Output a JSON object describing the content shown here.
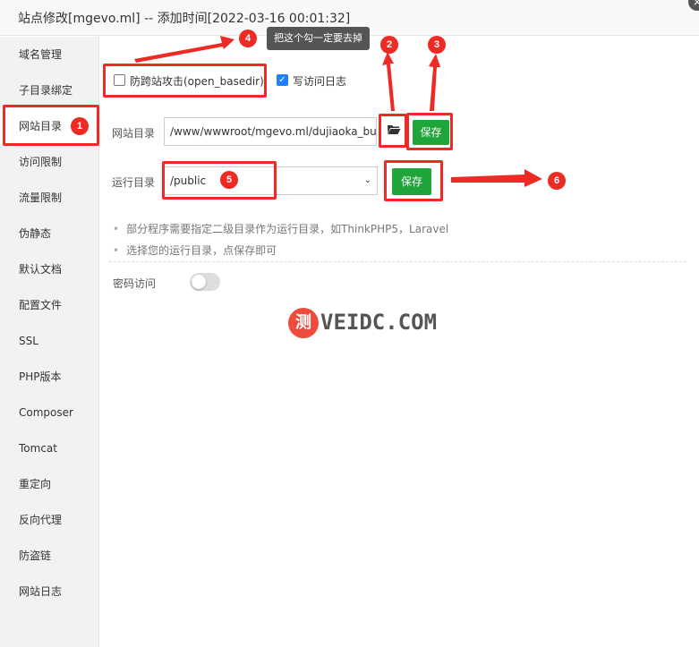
{
  "window": {
    "title": "站点修改[mgevo.ml] -- 添加时间[2022-03-16 00:01:32]",
    "close_icon": "×"
  },
  "sidebar": {
    "items": [
      {
        "label": "域名管理"
      },
      {
        "label": "子目录绑定"
      },
      {
        "label": "网站目录",
        "active": true
      },
      {
        "label": "访问限制"
      },
      {
        "label": "流量限制"
      },
      {
        "label": "伪静态"
      },
      {
        "label": "默认文档"
      },
      {
        "label": "配置文件"
      },
      {
        "label": "SSL"
      },
      {
        "label": "PHP版本"
      },
      {
        "label": "Composer"
      },
      {
        "label": "Tomcat"
      },
      {
        "label": "重定向"
      },
      {
        "label": "反向代理"
      },
      {
        "label": "防盗链"
      },
      {
        "label": "网站日志"
      }
    ]
  },
  "main": {
    "options": {
      "anti_xss_label": "防跨站攻击(open_basedir)",
      "anti_xss_checked": false,
      "access_log_label": "写访问日志",
      "access_log_checked": true,
      "check_glyph": "✓"
    },
    "site_dir": {
      "label": "网站目录",
      "value": "/www/wwwroot/mgevo.ml/dujiaoka_bui",
      "folder_icon": "folder-open-icon",
      "save_label": "保存"
    },
    "run_dir": {
      "label": "运行目录",
      "value": "/public",
      "arrow": "⌄",
      "save_label": "保存"
    },
    "tips": [
      "部分程序需要指定二级目录作为运行目录，如ThinkPHP5，Laravel",
      "选择您的运行目录，点保存即可"
    ],
    "password_access": {
      "label": "密码访问",
      "enabled": false
    }
  },
  "annotations": {
    "tooltip": "把这个勾一定要去掉",
    "badges": [
      "1",
      "2",
      "3",
      "4",
      "5",
      "6"
    ],
    "color": "#ee2a24"
  },
  "watermark": {
    "glyph": "测",
    "text": "VEIDC.COM"
  },
  "colors": {
    "accent_green": "#20a53a",
    "checkbox_blue": "#1e80ff",
    "annotation_red": "#ee2a24"
  }
}
